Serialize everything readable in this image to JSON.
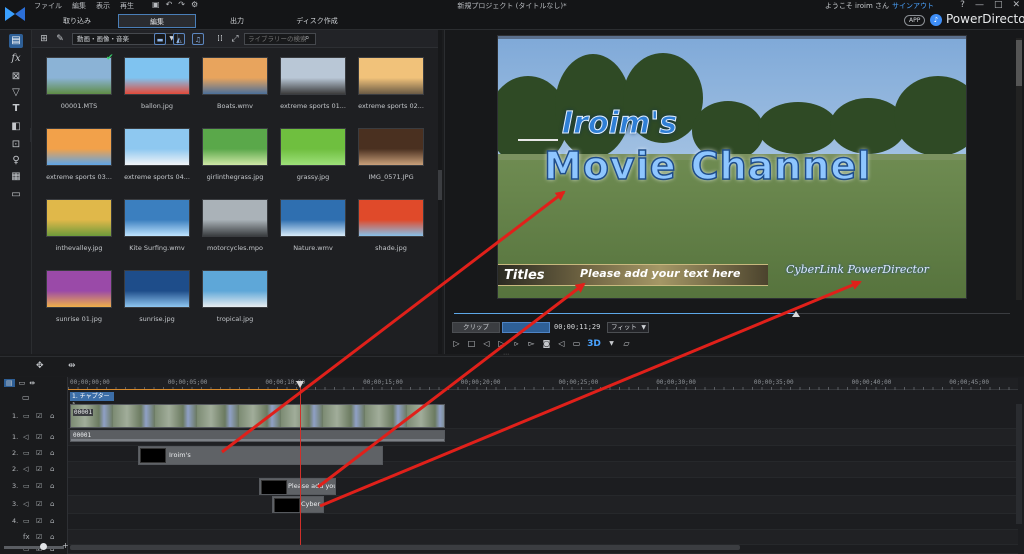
{
  "menu": [
    "ファイル",
    "編集",
    "表示",
    "再生"
  ],
  "quick_icons": [
    "▣",
    "↶",
    "↷",
    "⚙"
  ],
  "window_title": "新規プロジェクト (タイトルなし)*",
  "welcome": {
    "text": "ようこそ iroim さん",
    "signin": "サインアウト"
  },
  "window_buttons": [
    "?",
    "—",
    "□",
    "✕"
  ],
  "tabs": [
    "取り込み",
    "編集",
    "出力",
    "ディスク作成"
  ],
  "app_badge": "APP",
  "brand": "PowerDirector",
  "library": {
    "filter": "動画・画像・音楽",
    "search_placeholder": "ライブラリーの検索",
    "items": [
      {
        "label": "00001.MTS",
        "checked": true
      },
      {
        "label": "ballon.jpg"
      },
      {
        "label": "Boats.wmv"
      },
      {
        "label": "extreme sports 01..."
      },
      {
        "label": "extreme sports 02..."
      },
      {
        "label": "extreme sports 03..."
      },
      {
        "label": "extreme sports 04..."
      },
      {
        "label": "girlinthegrass.jpg"
      },
      {
        "label": "grassy.jpg"
      },
      {
        "label": "IMG_0571.JPG"
      },
      {
        "label": "inthevalley.jpg"
      },
      {
        "label": "Kite Surfing.wmv"
      },
      {
        "label": "motorcycles.mpo"
      },
      {
        "label": "Nature.wmv"
      },
      {
        "label": "shade.jpg"
      },
      {
        "label": "sunrise 01.jpg"
      },
      {
        "label": "sunrise.jpg"
      },
      {
        "label": "tropical.jpg"
      }
    ]
  },
  "preview": {
    "title_line1": "Iroim's",
    "title_line2": "Movie Channel",
    "lower_left": "Titles",
    "lower_text": "Please add your text here",
    "signature": "CyberLink PowerDirector",
    "clip_label": "クリップ",
    "movie_label": "ムービー",
    "timecode": "00;00;11;29",
    "fit": "フィット",
    "mode_3d": "3D"
  },
  "timeline": {
    "ticks": [
      "00;00;00;00",
      "00;00;05;00",
      "00;00;10;00",
      "00;00;15;00",
      "00;00;20;00",
      "00;00;25;00",
      "00;00;30;00",
      "00;00;35;00",
      "00;00;40;00",
      "00;00;45;00"
    ],
    "chapter": "1. チャプター 1",
    "tracks": [
      "1.",
      "1.",
      "2.",
      "2.",
      "3.",
      "3.",
      "4.",
      "",
      ""
    ],
    "video_clip_id": "00001",
    "audio_clip_id": "00001",
    "title_clip_1": "Iroim's",
    "title_clip_2": "Please add your",
    "title_clip_3": "Cyber"
  },
  "colors": {
    "accent": "#2e5f96",
    "playhead": "#d0302a",
    "arrow": "#e0201a"
  }
}
